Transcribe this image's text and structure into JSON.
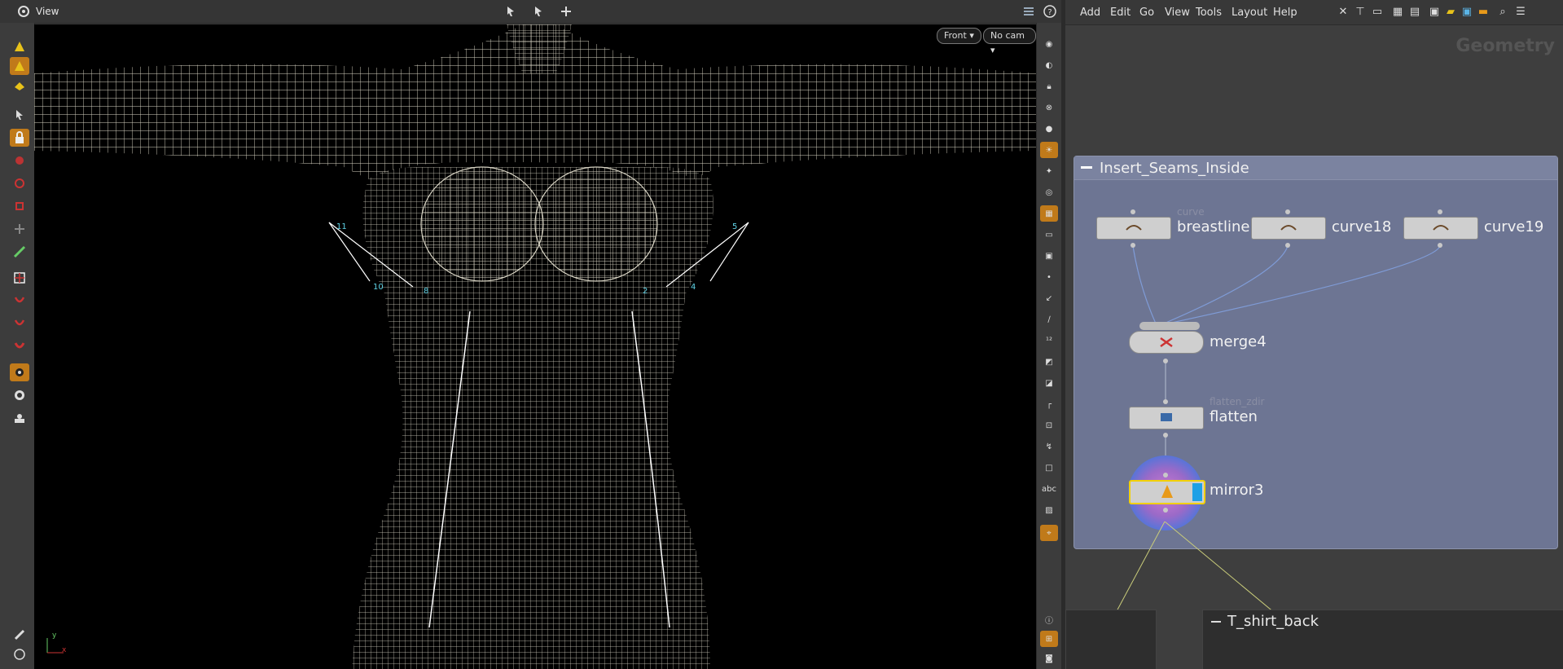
{
  "viewer": {
    "title": "View",
    "view_menu": "Front",
    "camera_menu": "No cam",
    "axis_y": "y",
    "axis_x": "x",
    "point_labels": [
      "11",
      "10",
      "8",
      "2",
      "4",
      "5"
    ]
  },
  "network": {
    "menu": [
      "Add",
      "Edit",
      "Go",
      "View",
      "Tools",
      "Layout",
      "Help"
    ],
    "context_label": "Geometry",
    "box_title": "Insert_Seams_Inside",
    "nodes": [
      {
        "name": "breastline",
        "comment": "curve"
      },
      {
        "name": "curve18",
        "comment": ""
      },
      {
        "name": "curve19",
        "comment": ""
      },
      {
        "name": "merge4",
        "comment": ""
      },
      {
        "name": "flatten",
        "comment": "flatten_zdir"
      },
      {
        "name": "mirror3",
        "comment": ""
      }
    ],
    "second_box_title": "T_shirt_back"
  },
  "colors": {
    "active_tool": "#c07a1a",
    "network_box": "#6d7593",
    "wire": "#7f9bd6",
    "mesh": "#d8d4c4",
    "point_label": "#5fd3e6",
    "selected_node": "#f2d000",
    "display_flag": "#1ea0e6"
  }
}
